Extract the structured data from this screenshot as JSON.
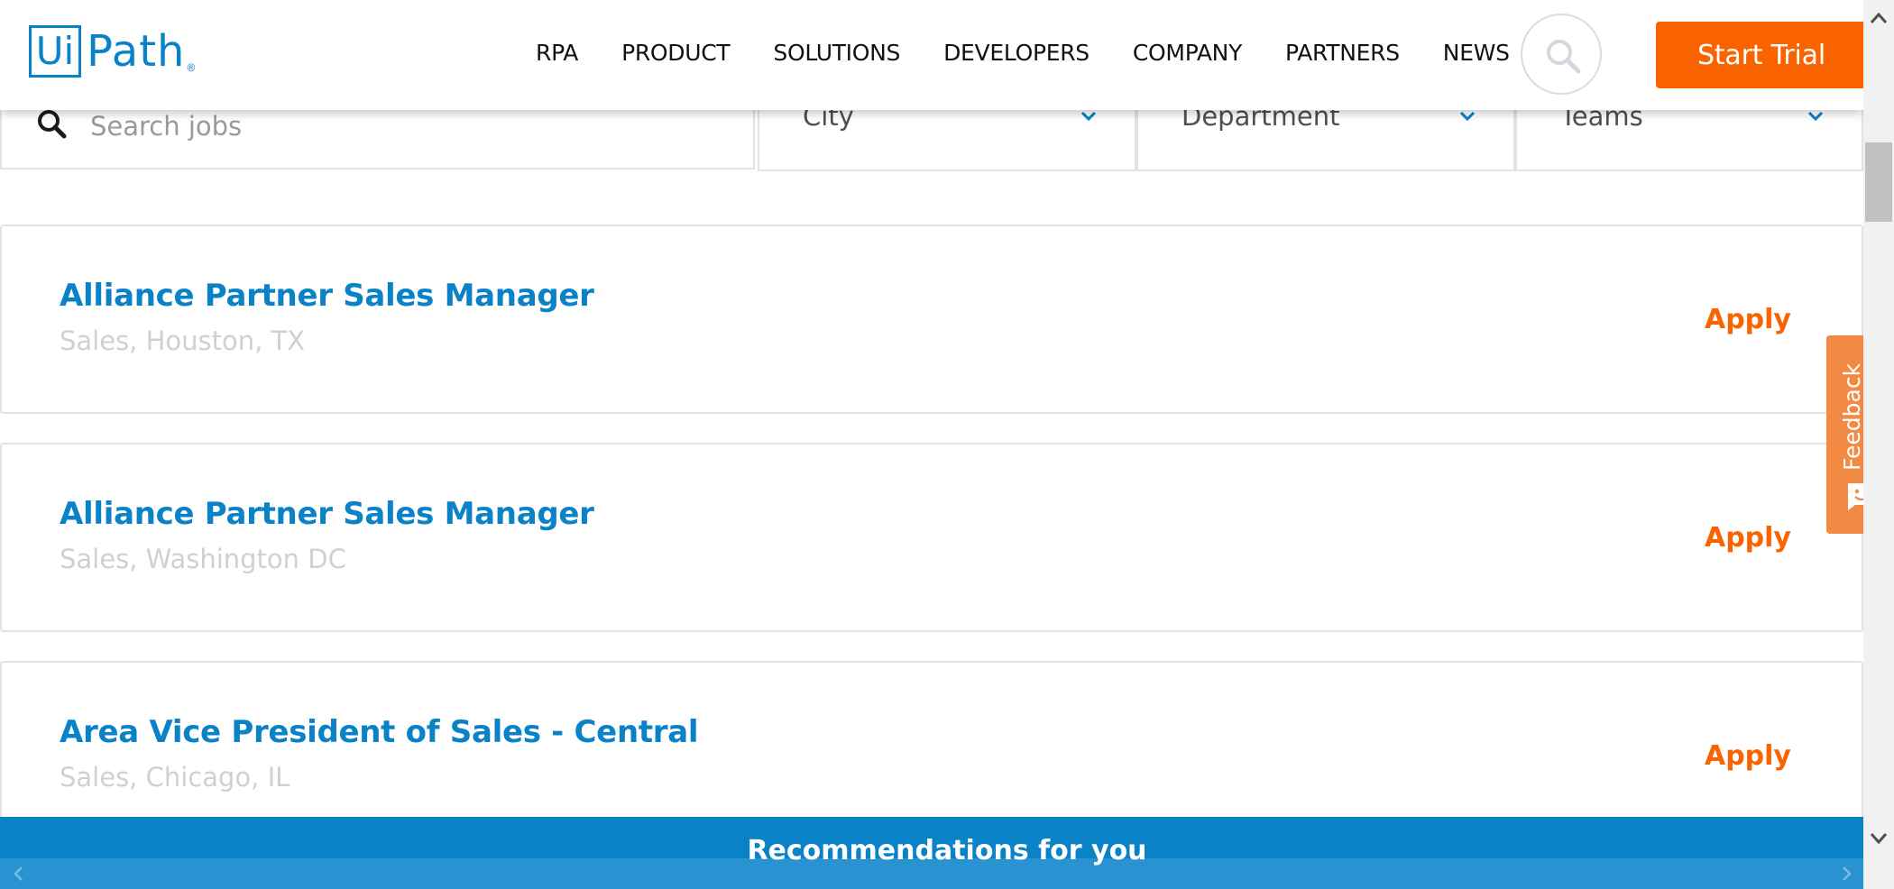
{
  "header": {
    "logo": {
      "ui": "Ui",
      "path": "Path",
      "reg": "®"
    },
    "nav": [
      {
        "label": "RPA"
      },
      {
        "label": "PRODUCT"
      },
      {
        "label": "SOLUTIONS"
      },
      {
        "label": "DEVELOPERS"
      },
      {
        "label": "COMPANY"
      },
      {
        "label": "PARTNERS"
      },
      {
        "label": "NEWS"
      }
    ],
    "search_icon": "search-icon",
    "cta_label": "Start Trial"
  },
  "filters": {
    "search_placeholder": "Search jobs",
    "search_value": "",
    "city": "City",
    "department": "Department",
    "teams": "Teams"
  },
  "jobs": [
    {
      "title": "Alliance Partner Sales Manager",
      "meta": "Sales, Houston, TX",
      "apply": "Apply"
    },
    {
      "title": "Alliance Partner Sales Manager",
      "meta": "Sales, Washington DC",
      "apply": "Apply"
    },
    {
      "title": "Area Vice President of Sales - Central",
      "meta": "Sales, Chicago, IL",
      "apply": "Apply"
    }
  ],
  "feedback": {
    "label": "Feedback"
  },
  "recommendations": {
    "label": "Recommendations for you"
  },
  "colors": {
    "brand_blue": "#0a82c8",
    "accent_orange": "#fa6400",
    "feedback_orange": "#f38a43"
  }
}
